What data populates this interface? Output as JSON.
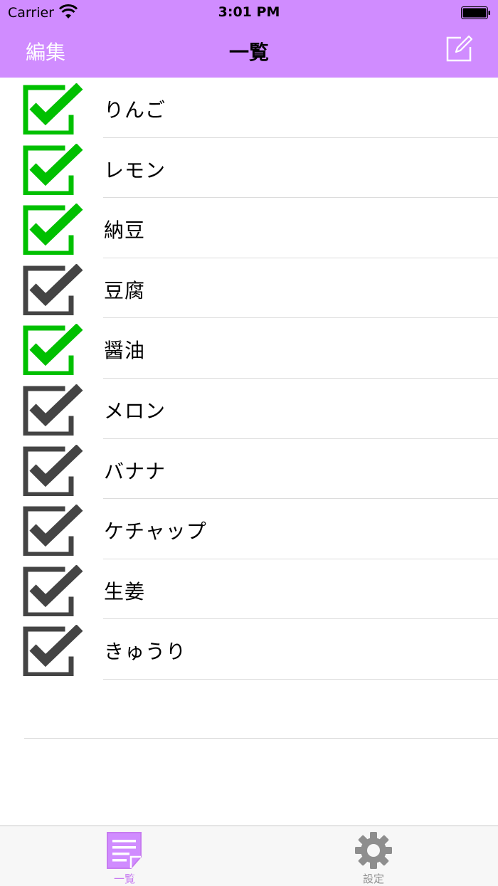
{
  "status_bar": {
    "carrier": "Carrier",
    "time": "3:01 PM"
  },
  "nav": {
    "edit_label": "編集",
    "title": "一覧",
    "compose_icon": "compose-icon"
  },
  "colors": {
    "nav_bg": "#D08CFF",
    "checked": "#00C000",
    "unchecked": "#444444",
    "tab_active": "#C77CF0",
    "tab_inactive": "#8e8e8e"
  },
  "items": [
    {
      "label": "りんご",
      "checked": true
    },
    {
      "label": "レモン",
      "checked": true
    },
    {
      "label": "納豆",
      "checked": true
    },
    {
      "label": "豆腐",
      "checked": false
    },
    {
      "label": "醤油",
      "checked": true
    },
    {
      "label": "メロン",
      "checked": false
    },
    {
      "label": "バナナ",
      "checked": false
    },
    {
      "label": "ケチャップ",
      "checked": false
    },
    {
      "label": "生姜",
      "checked": false
    },
    {
      "label": "きゅうり",
      "checked": false
    }
  ],
  "tabs": [
    {
      "label": "一覧",
      "icon": "list-icon",
      "active": true
    },
    {
      "label": "設定",
      "icon": "gear-icon",
      "active": false
    }
  ]
}
